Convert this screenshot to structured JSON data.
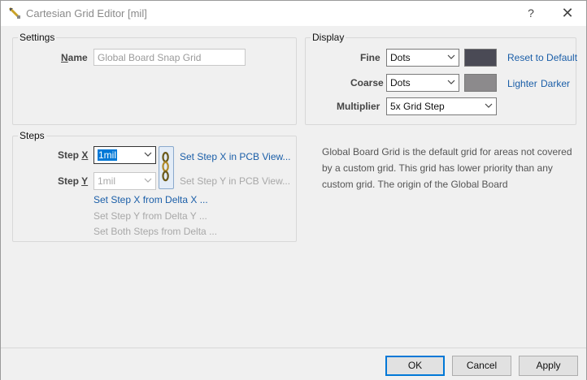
{
  "window": {
    "title": "Cartesian Grid Editor [mil]",
    "help_label": "?",
    "close_label": "✕"
  },
  "settings": {
    "group_label": "Settings",
    "name_label": "Name",
    "name_value": "Global Board Snap Grid"
  },
  "display": {
    "group_label": "Display",
    "fine_label": "Fine",
    "fine_value": "Dots",
    "fine_color": "#4a4a55",
    "reset_link": "Reset to Default",
    "coarse_label": "Coarse",
    "coarse_value": "Dots",
    "coarse_color": "#8c8a8c",
    "lighter_link": "Lighter",
    "darker_link": "Darker",
    "multiplier_label": "Multiplier",
    "multiplier_value": "5x Grid Step"
  },
  "steps": {
    "group_label": "Steps",
    "step_x_label": "Step X",
    "step_x_value": "1mil",
    "step_y_label": "Step Y",
    "step_y_value": "1mil",
    "set_x_pcb": "Set Step X in PCB View...",
    "set_y_pcb": "Set Step Y in PCB View...",
    "set_x_delta": "Set Step X from Delta X ...",
    "set_y_delta": "Set Step Y from Delta Y ...",
    "set_both_delta": "Set Both Steps from Delta ..."
  },
  "description": "Global Board Grid is the default grid for areas not covered by a custom grid. This grid has lower priority than any custom grid. The origin of the Global Board",
  "footer": {
    "ok": "OK",
    "cancel": "Cancel",
    "apply": "Apply"
  },
  "colors": {
    "accent": "#0078d7",
    "link": "#1a5ea8"
  }
}
